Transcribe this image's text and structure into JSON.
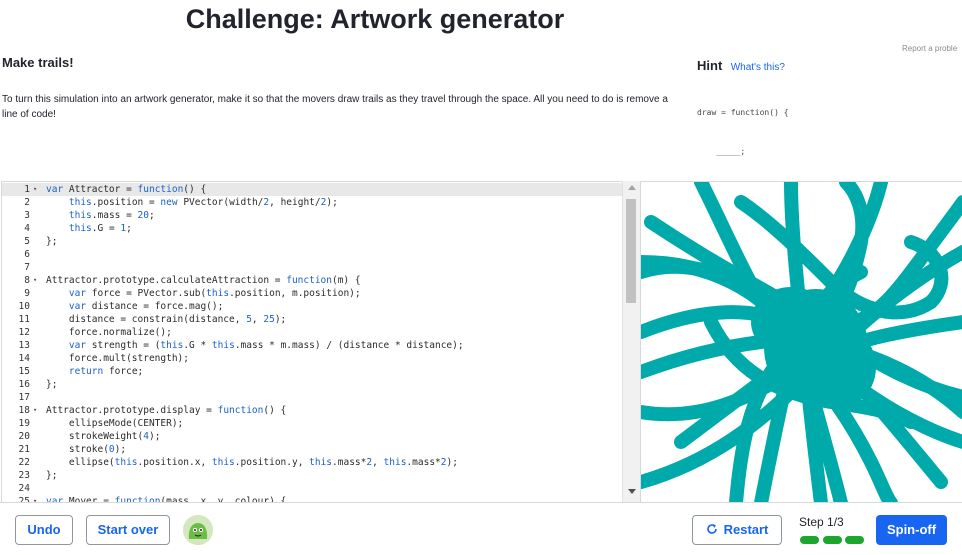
{
  "header": {
    "title": "Challenge: Artwork generator",
    "report_link": "Report a proble"
  },
  "step_info": {
    "subtitle": "Make trails!",
    "description": "To turn this simulation into an artwork generator, make it so that the movers draw trails as they travel through the space. All you need to do is remove a line of code!"
  },
  "hint": {
    "title": "Hint",
    "link": "What's this?",
    "code_lines": [
      "draw = function() {",
      "    _____;",
      "};"
    ]
  },
  "editor": {
    "active_line": 1,
    "lines": [
      {
        "n": "1",
        "fold": "▾",
        "text": "var Attractor = function() {"
      },
      {
        "n": "2",
        "fold": "",
        "text": "    this.position = new PVector(width/2, height/2);"
      },
      {
        "n": "3",
        "fold": "",
        "text": "    this.mass = 20;"
      },
      {
        "n": "4",
        "fold": "",
        "text": "    this.G = 1;"
      },
      {
        "n": "5",
        "fold": "",
        "text": "};"
      },
      {
        "n": "6",
        "fold": "",
        "text": ""
      },
      {
        "n": "7",
        "fold": "",
        "text": ""
      },
      {
        "n": "8",
        "fold": "▾",
        "text": "Attractor.prototype.calculateAttraction = function(m) {"
      },
      {
        "n": "9",
        "fold": "",
        "text": "    var force = PVector.sub(this.position, m.position);"
      },
      {
        "n": "10",
        "fold": "",
        "text": "    var distance = force.mag();"
      },
      {
        "n": "11",
        "fold": "",
        "text": "    distance = constrain(distance, 5, 25);"
      },
      {
        "n": "12",
        "fold": "",
        "text": "    force.normalize();"
      },
      {
        "n": "13",
        "fold": "",
        "text": "    var strength = (this.G * this.mass * m.mass) / (distance * distance);"
      },
      {
        "n": "14",
        "fold": "",
        "text": "    force.mult(strength);"
      },
      {
        "n": "15",
        "fold": "",
        "text": "    return force;"
      },
      {
        "n": "16",
        "fold": "",
        "text": "};"
      },
      {
        "n": "17",
        "fold": "",
        "text": ""
      },
      {
        "n": "18",
        "fold": "▾",
        "text": "Attractor.prototype.display = function() {"
      },
      {
        "n": "19",
        "fold": "",
        "text": "    ellipseMode(CENTER);"
      },
      {
        "n": "20",
        "fold": "",
        "text": "    strokeWeight(4);"
      },
      {
        "n": "21",
        "fold": "",
        "text": "    stroke(0);"
      },
      {
        "n": "22",
        "fold": "",
        "text": "    ellipse(this.position.x, this.position.y, this.mass*2, this.mass*2);"
      },
      {
        "n": "23",
        "fold": "",
        "text": "};"
      },
      {
        "n": "24",
        "fold": "",
        "text": ""
      },
      {
        "n": "25",
        "fold": "▾",
        "text": "var Mover = function(mass, x, y, colour) {"
      }
    ]
  },
  "output": {
    "trail_color": "#00aaaa"
  },
  "footer": {
    "undo": "Undo",
    "start_over": "Start over",
    "restart": "Restart",
    "step_label": "Step 1/3",
    "spin_off": "Spin-off",
    "progress_total": 3,
    "progress_done": 3,
    "progress_color": "#1ca62c",
    "accent": "#1865f2"
  }
}
